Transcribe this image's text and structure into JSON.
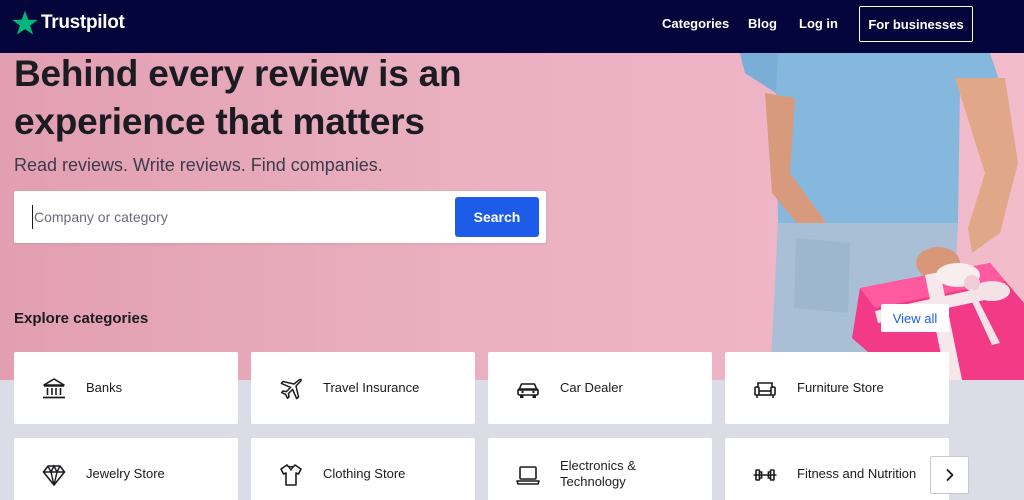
{
  "brand": {
    "name": "Trustpilot",
    "star_color": "#00b67a"
  },
  "nav": {
    "links": [
      "Categories",
      "Blog",
      "Log in"
    ],
    "business_button": "For businesses",
    "background": "#04053a"
  },
  "hero": {
    "title_line1": "Behind every review is an",
    "title_line2": "experience that matters",
    "subtitle": "Read reviews. Write reviews. Find companies."
  },
  "search": {
    "placeholder": "Company or category",
    "value": "",
    "button_label": "Search",
    "button_color": "#1c5ce8"
  },
  "categories": {
    "heading": "Explore categories",
    "view_all_label": "View all",
    "items": [
      {
        "label": "Banks",
        "icon": "bank-icon"
      },
      {
        "label": "Travel Insurance",
        "icon": "airplane-icon"
      },
      {
        "label": "Car Dealer",
        "icon": "car-icon"
      },
      {
        "label": "Furniture Store",
        "icon": "sofa-icon"
      },
      {
        "label": "Jewelry Store",
        "icon": "diamond-icon"
      },
      {
        "label": "Clothing Store",
        "icon": "shirt-icon"
      },
      {
        "label": "Electronics & Technology",
        "icon": "laptop-icon"
      },
      {
        "label": "Fitness and Nutrition",
        "icon": "dumbbell-icon"
      }
    ],
    "next_icon": "chevron-right-icon"
  }
}
